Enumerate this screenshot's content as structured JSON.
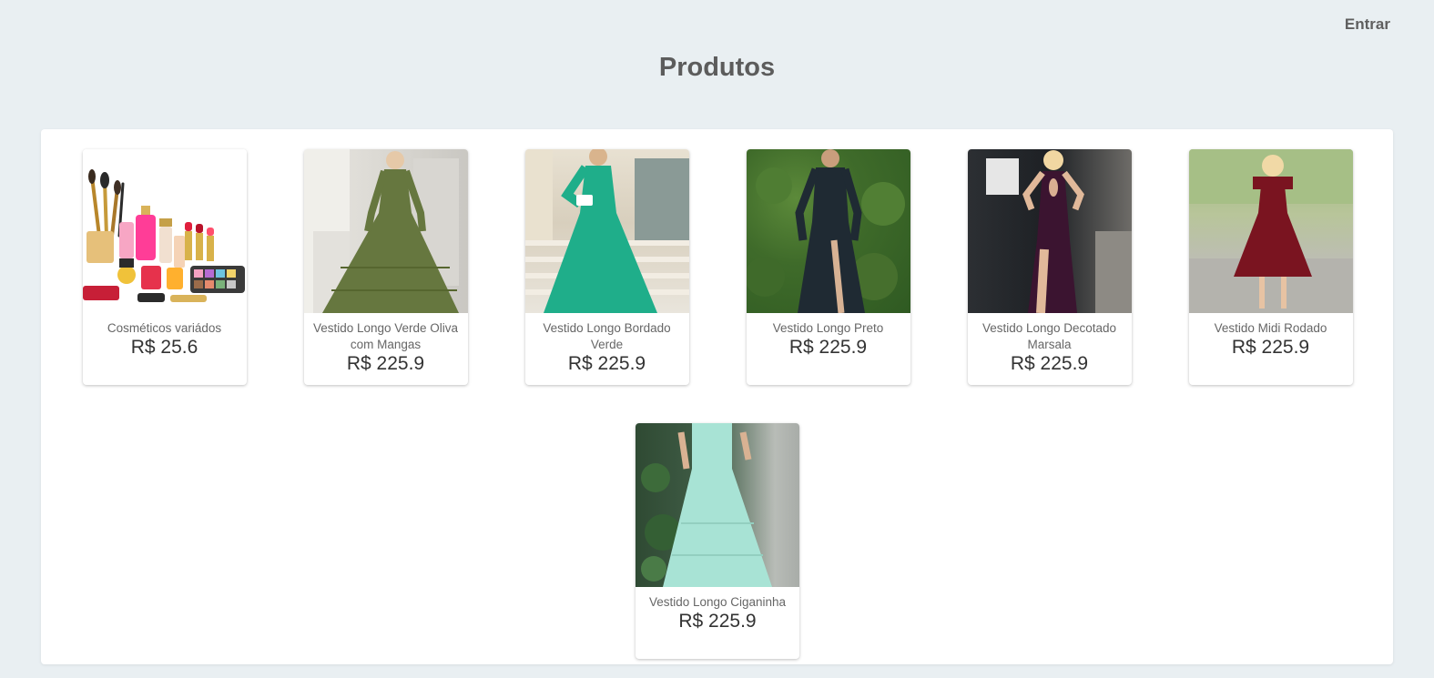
{
  "header": {
    "login_label": "Entrar",
    "title": "Produtos"
  },
  "products": [
    {
      "name": "Cosméticos variádos",
      "price": "R$ 25.6",
      "image_icon": "cosmetics-image"
    },
    {
      "name": "Vestido Longo Verde Oliva com Mangas",
      "price": "R$ 225.9",
      "image_icon": "dress-image",
      "dress_color": "#66773f"
    },
    {
      "name": "Vestido Longo Bordado Verde",
      "price": "R$ 225.9",
      "image_icon": "dress-image",
      "dress_color": "#1fae8a"
    },
    {
      "name": "Vestido Longo Preto",
      "price": "R$ 225.9",
      "image_icon": "dress-image",
      "dress_color": "#1f2a33"
    },
    {
      "name": "Vestido Longo Decotado Marsala",
      "price": "R$ 225.9",
      "image_icon": "dress-image",
      "dress_color": "#3b1430"
    },
    {
      "name": "Vestido Midi Rodado",
      "price": "R$ 225.9",
      "image_icon": "dress-image",
      "dress_color": "#7a1420"
    },
    {
      "name": "Vestido Longo Ciganinha",
      "price": "R$ 225.9",
      "image_icon": "dress-image",
      "dress_color": "#a8e3d5"
    }
  ]
}
